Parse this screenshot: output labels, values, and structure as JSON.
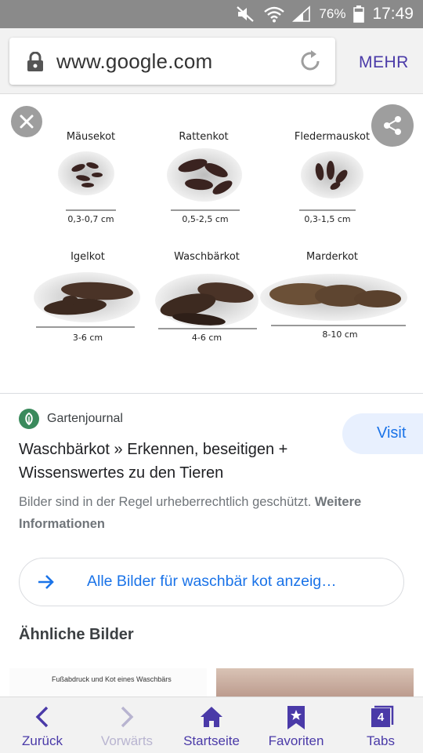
{
  "status_bar": {
    "battery": "76%",
    "time": "17:49"
  },
  "browser": {
    "url": "www.google.com",
    "menu_label": "MEHR"
  },
  "image": {
    "row1": [
      {
        "name": "Mäusekot",
        "size": "0,3-0,7 cm"
      },
      {
        "name": "Rattenkot",
        "size": "0,5-2,5 cm"
      },
      {
        "name": "Fledermauskot",
        "size": "0,3-1,5 cm"
      }
    ],
    "row2": [
      {
        "name": "Igelkot",
        "size": "3-6 cm"
      },
      {
        "name": "Waschbärkot",
        "size": "4-6 cm"
      },
      {
        "name": "Marderkot",
        "size": "8-10 cm"
      }
    ]
  },
  "result": {
    "source": "Gartenjournal",
    "visit_label": "Visit",
    "title": "Waschbärkot » Erkennen, beseitigen + Wissenswertes zu den Tieren",
    "copyright_text": "Bilder sind in der Regel urheberrechtlich geschützt.",
    "copyright_link": "Weitere Informationen",
    "all_images_label": "Alle Bilder für waschbär kot anzeig…",
    "similar_heading": "Ähnliche Bilder",
    "thumb1_caption": "Fußabdruck und Kot eines Waschbärs"
  },
  "bottom_nav": {
    "back": "Zurück",
    "forward": "Vorwärts",
    "home": "Startseite",
    "favorites": "Favoriten",
    "tabs": "Tabs",
    "tab_count": "4"
  },
  "colors": {
    "accent": "#4a3aa8",
    "link_blue": "#1a73e8",
    "status_bar": "#8a8a8a"
  }
}
